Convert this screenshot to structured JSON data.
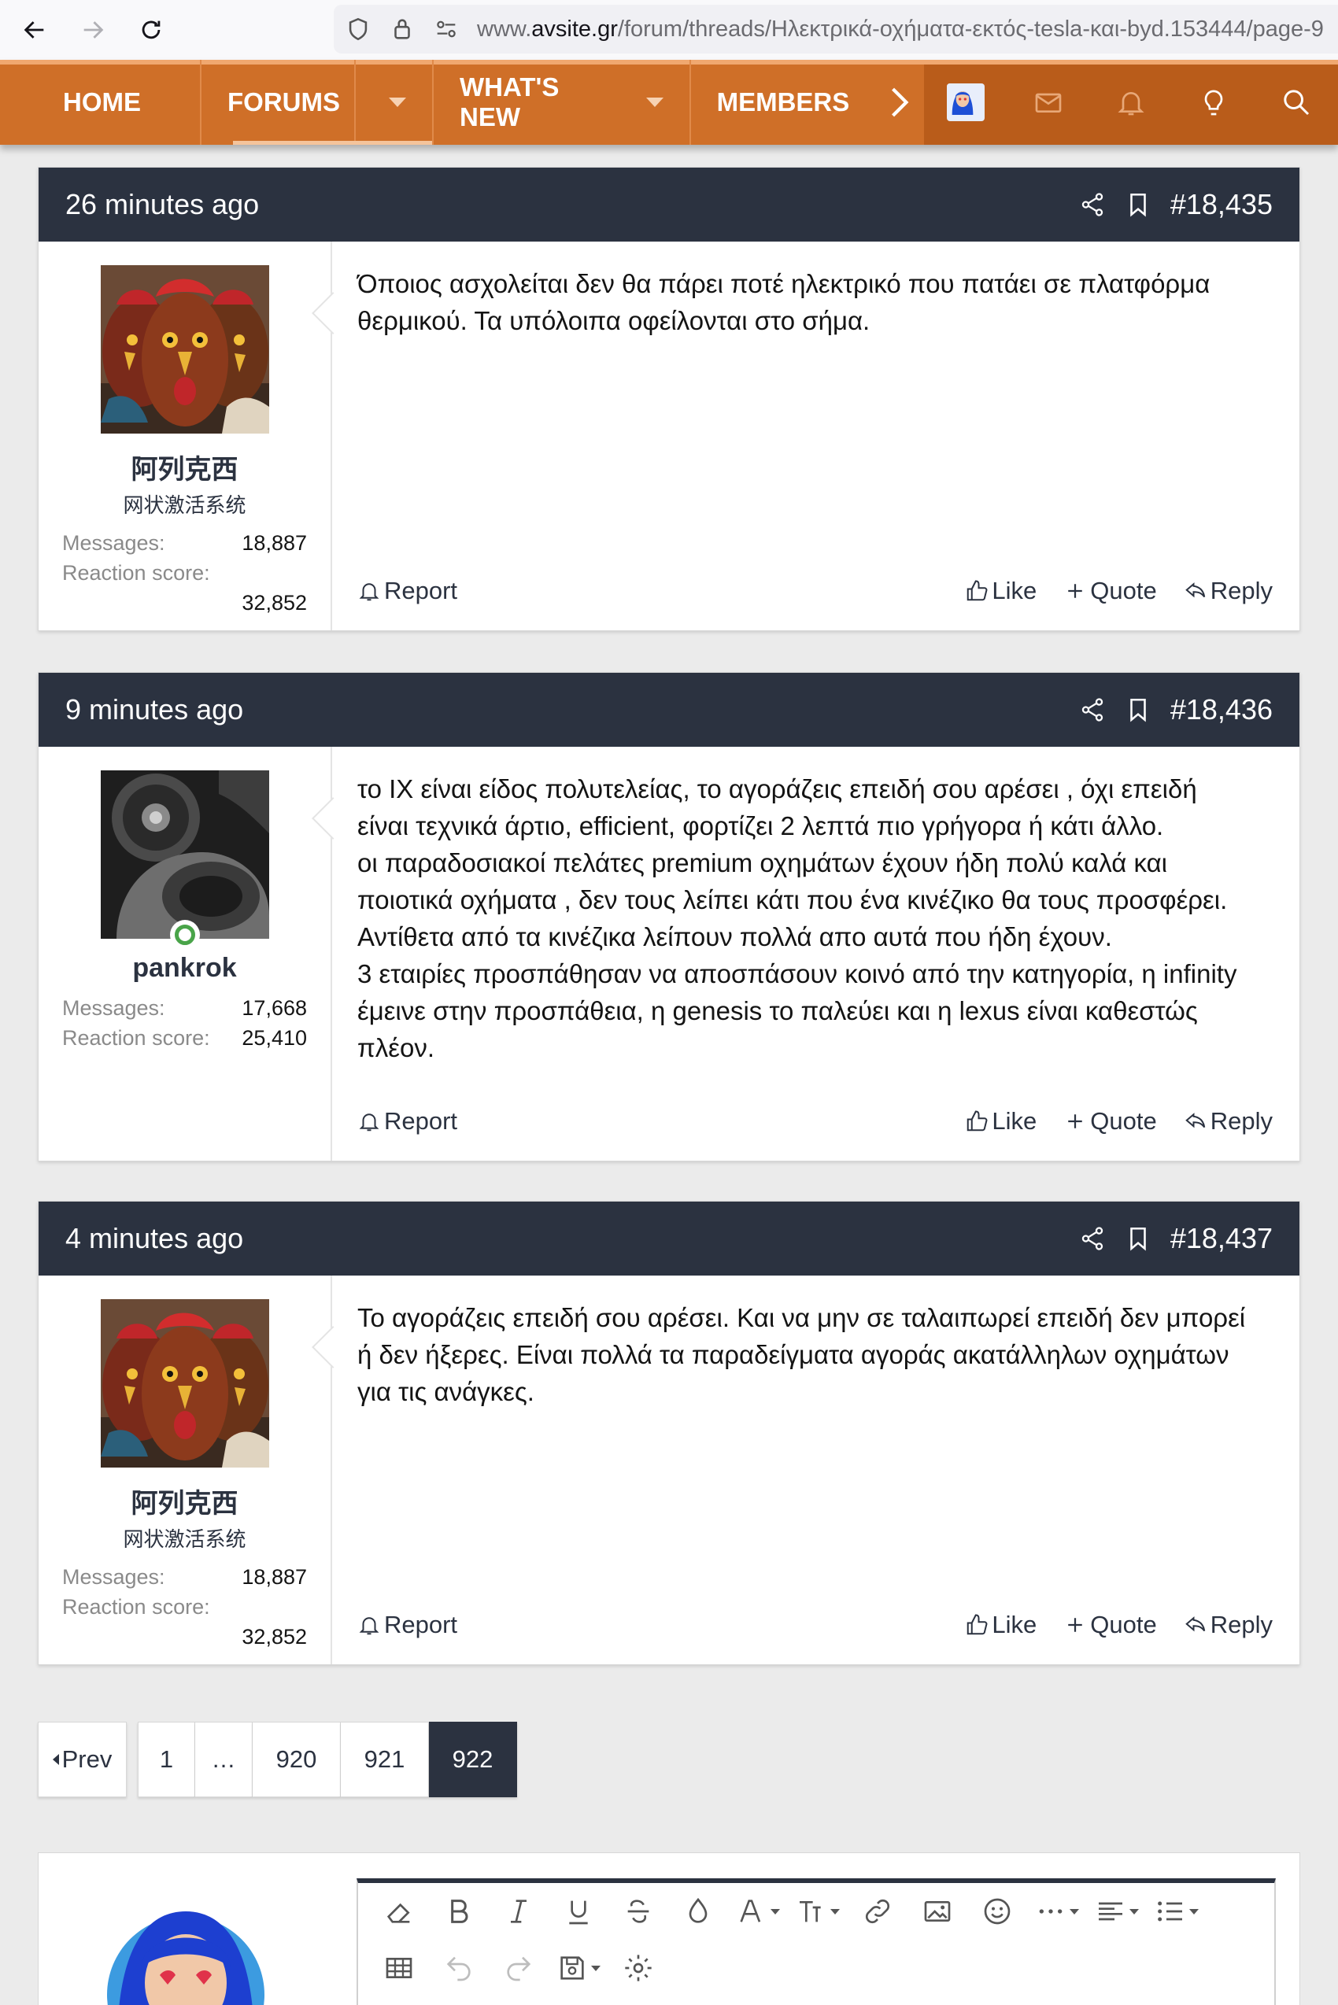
{
  "browser": {
    "url_prefix": "www.",
    "url_host": "avsite.gr",
    "url_path": "/forum/threads/Ηλεκτρικά-οχήματα-εκτός-tesla-και-byd.153444/page-9"
  },
  "nav": {
    "home": "HOME",
    "forums": "FORUMS",
    "whats_new": "WHAT'S NEW",
    "members": "MEMBERS"
  },
  "posts": [
    {
      "time": "26 minutes ago",
      "number": "#18,435",
      "username": "阿列克西",
      "user_title": "网状激活系统",
      "messages_label": "Messages:",
      "messages": "18,887",
      "reaction_label": "Reaction score:",
      "reaction": "32,852",
      "body": "Όποιος ασχολείται δεν θα πάρει ποτέ ηλεκτρικό που πατάει σε πλατφόρμα\nθερμικού. Τα υπόλοιπα οφείλονται στο σήμα."
    },
    {
      "time": "9 minutes ago",
      "number": "#18,436",
      "username": "pankrok",
      "user_title": "",
      "messages_label": "Messages:",
      "messages": "17,668",
      "reaction_label": "Reaction score:",
      "reaction": "25,410",
      "body": "το ΙΧ είναι είδος πολυτελείας, το αγοράζεις επειδή σου αρέσει , όχι επειδή\nείναι τεχνικά άρτιο, efficient, φορτίζει 2 λεπτά πιο γρήγορα ή κάτι άλλο.\nοι παραδοσιακοί πελάτες premium οχημάτων έχουν ήδη πολύ καλά και\nποιοτικά οχήματα , δεν τους λείπει κάτι που ένα κινέζικο θα τους προσφέρει.\nΑντίθετα από τα κινέζικα λείπουν πολλά απο αυτά που ήδη έχουν.\n3 εταιρίες προσπάθησαν να αποσπάσουν κοινό από την κατηγορία, η infinity\nέμεινε στην προσπάθεια, η genesis το παλεύει και η lexus είναι καθεστώς\nπλέον."
    },
    {
      "time": "4 minutes ago",
      "number": "#18,437",
      "username": "阿列克西",
      "user_title": "网状激活系统",
      "messages_label": "Messages:",
      "messages": "18,887",
      "reaction_label": "Reaction score:",
      "reaction": "32,852",
      "body": "Το αγοράζεις επειδή σου αρέσει. Και να μην σε ταλαιπωρεί επειδή δεν μπορεί\nή δεν ήξερες. Είναι πολλά τα παραδείγματα αγοράς ακατάλληλων οχημάτων\nγια τις ανάγκες."
    }
  ],
  "actions": {
    "report": "Report",
    "like": "Like",
    "quote": "Quote",
    "reply": "Reply"
  },
  "pagination": {
    "prev": "Prev",
    "pages": [
      "1",
      "…",
      "920",
      "921",
      "922"
    ],
    "current": "922"
  },
  "colors": {
    "nav_orange": "#cf6f28",
    "header_dark": "#2b3240",
    "online_green": "#49a449"
  }
}
